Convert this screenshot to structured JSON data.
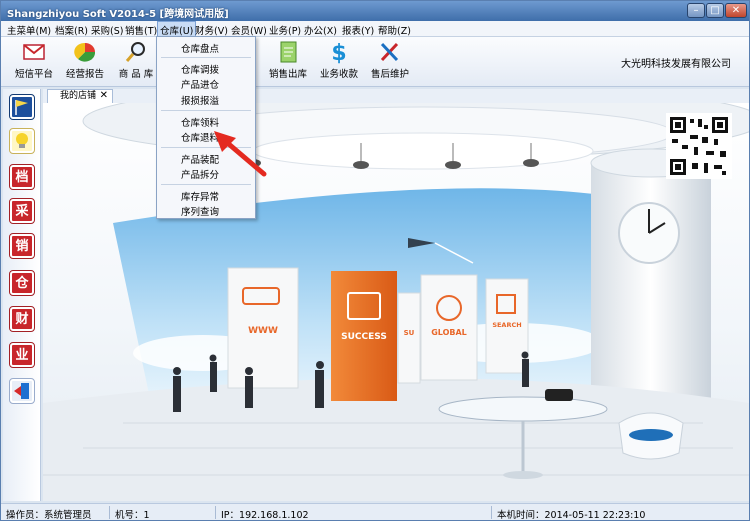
{
  "window": {
    "title": "Shangzhiyou Soft V2014-5 [跨境网试用版]",
    "buttons": {
      "minimize": "–",
      "maximize": "□",
      "close": "✕"
    }
  },
  "menu": [
    {
      "label": "主菜单(M)"
    },
    {
      "label": "档案(R)"
    },
    {
      "label": "采购(S)"
    },
    {
      "label": "销售(T)"
    },
    {
      "label": "仓库(U)"
    },
    {
      "label": "财务(V)"
    },
    {
      "label": "会员(W)"
    },
    {
      "label": "业务(P)"
    },
    {
      "label": "办公(X)"
    },
    {
      "label": "报表(Y)"
    },
    {
      "label": "帮助(Z)"
    }
  ],
  "toolbar": [
    {
      "label": "短信平台",
      "icon": "envelope-icon"
    },
    {
      "label": "经营报告",
      "icon": "pie-chart-icon"
    },
    {
      "label": "商 品 库",
      "icon": "magnifier-icon"
    },
    {
      "label": "销售出库",
      "icon": "document-icon"
    },
    {
      "label": "业务收款",
      "icon": "dollar-icon"
    },
    {
      "label": "售后维护",
      "icon": "tools-icon"
    }
  ],
  "company": "大光明科技发展有限公司",
  "sidebar": [
    {
      "label": "",
      "icon": "flag-icon"
    },
    {
      "label": "",
      "icon": "lightbulb-icon"
    },
    {
      "label": "档"
    },
    {
      "label": "采"
    },
    {
      "label": "销"
    },
    {
      "label": "仓"
    },
    {
      "label": "财"
    },
    {
      "label": "业"
    },
    {
      "label": "",
      "icon": "exit-icon"
    }
  ],
  "tab": {
    "label": "我的店铺",
    "close": "✕"
  },
  "scene": {
    "boards": [
      "WWW",
      "SUCCESS",
      "SU",
      "GLOBAL",
      "SEARCH"
    ]
  },
  "dropdown": [
    "仓库盘点",
    "仓库调拨",
    "产品进仓",
    "报损报溢",
    "仓库领料",
    "仓库退料",
    "产品装配",
    "产品拆分",
    "库存异常",
    "序列查询"
  ],
  "status": {
    "operator": "操作员：系统管理员",
    "machine": "机号：1",
    "ip": "IP：192.168.1.102",
    "time": "本机时间：2014-05-11 22:23:10"
  },
  "colors": {
    "accent": "#e8672a",
    "red": "#c8262b",
    "titlebar": "#3f6eaa"
  }
}
